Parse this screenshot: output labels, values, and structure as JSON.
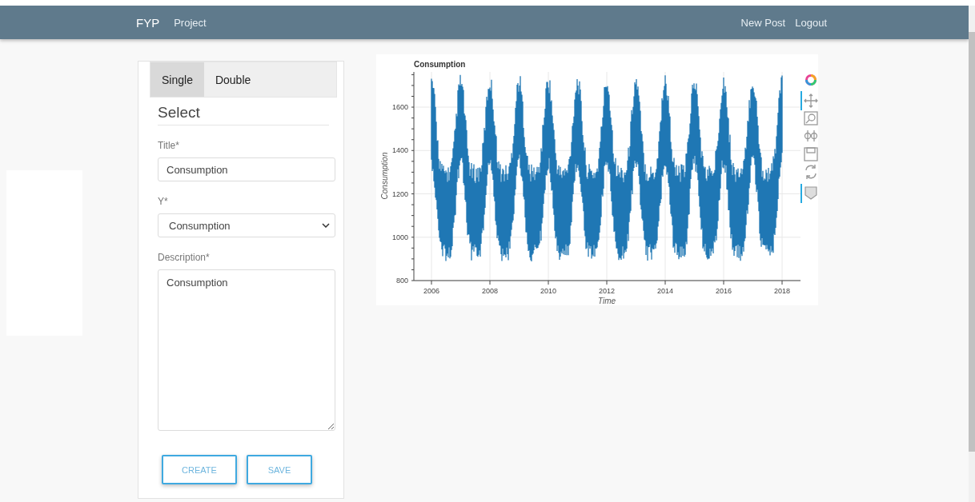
{
  "navbar": {
    "brand": "FYP",
    "links": [
      {
        "label": "Project"
      }
    ],
    "right_links": [
      {
        "label": "New Post"
      },
      {
        "label": "Logout"
      }
    ]
  },
  "tabs": [
    {
      "label": "Single",
      "selected": true
    },
    {
      "label": "Double",
      "selected": false
    }
  ],
  "form": {
    "heading": "Select",
    "fields": [
      {
        "kind": "text",
        "label": "Title*",
        "value": "Consumption"
      },
      {
        "kind": "select",
        "label": "Y*",
        "value": "Consumption"
      },
      {
        "kind": "textarea",
        "label": "Description*",
        "value": "Consumption"
      }
    ],
    "buttons": [
      "CREATE",
      "SAVE"
    ]
  },
  "plot": {
    "title": "Consumption",
    "ylabel": "Consumption",
    "xlabel": "Time",
    "yticks": [
      "1600",
      "1400",
      "1200",
      "1000",
      "800"
    ],
    "xticks": [
      "2006",
      "2008",
      "2010",
      "2012",
      "2014",
      "2016",
      "2018"
    ]
  }
}
